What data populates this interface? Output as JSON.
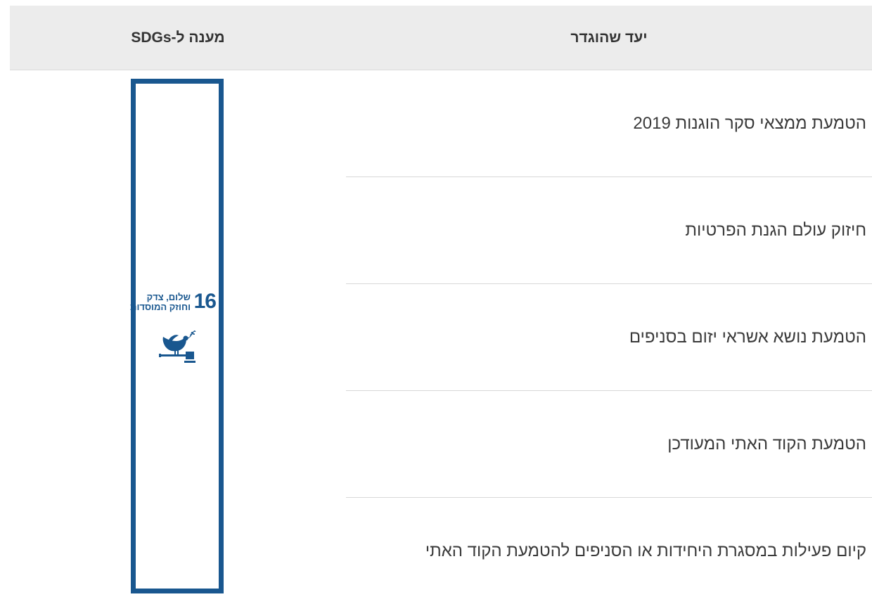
{
  "table": {
    "headers": {
      "goal": "יעד שהוגדר",
      "sdg": "מענה ל-SDGs"
    },
    "rows": [
      "הטמעת ממצאי סקר הוגנות 2019",
      "חיזוק עולם הגנת הפרטיות",
      "הטמעת נושא אשראי יזום בסניפים",
      "הטמעת הקוד האתי המעודכן",
      "קיום פעילות במסגרת היחידות או הסניפים להטמעת הקוד האתי"
    ],
    "sdg": {
      "number": "16",
      "label_line1": "שלום, צדק",
      "label_line2": "וחוזק המוסדות",
      "icon": "dove-gavel-icon",
      "color": "#19578f"
    }
  }
}
